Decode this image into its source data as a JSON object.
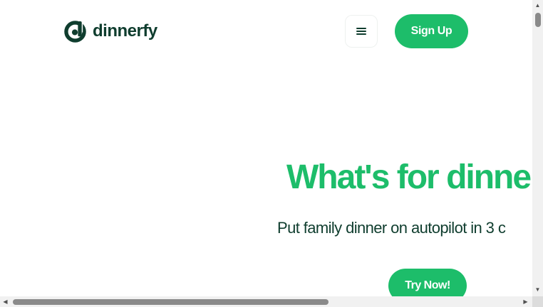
{
  "brand": {
    "name": "dinnerfy",
    "logo_icon": "dinnerfy-logo-icon",
    "primary_color": "#1dbd6a",
    "dark_color": "#0f3d2e"
  },
  "header": {
    "menu_icon": "hamburger-menu-icon",
    "signup_label": "Sign Up"
  },
  "hero": {
    "title": "What's for dinner?",
    "subtitle": "Put family dinner on autopilot in 3 c",
    "cta_label": "Try Now!"
  },
  "scrollbars": {
    "vertical_position": 0,
    "horizontal_position": 0
  }
}
